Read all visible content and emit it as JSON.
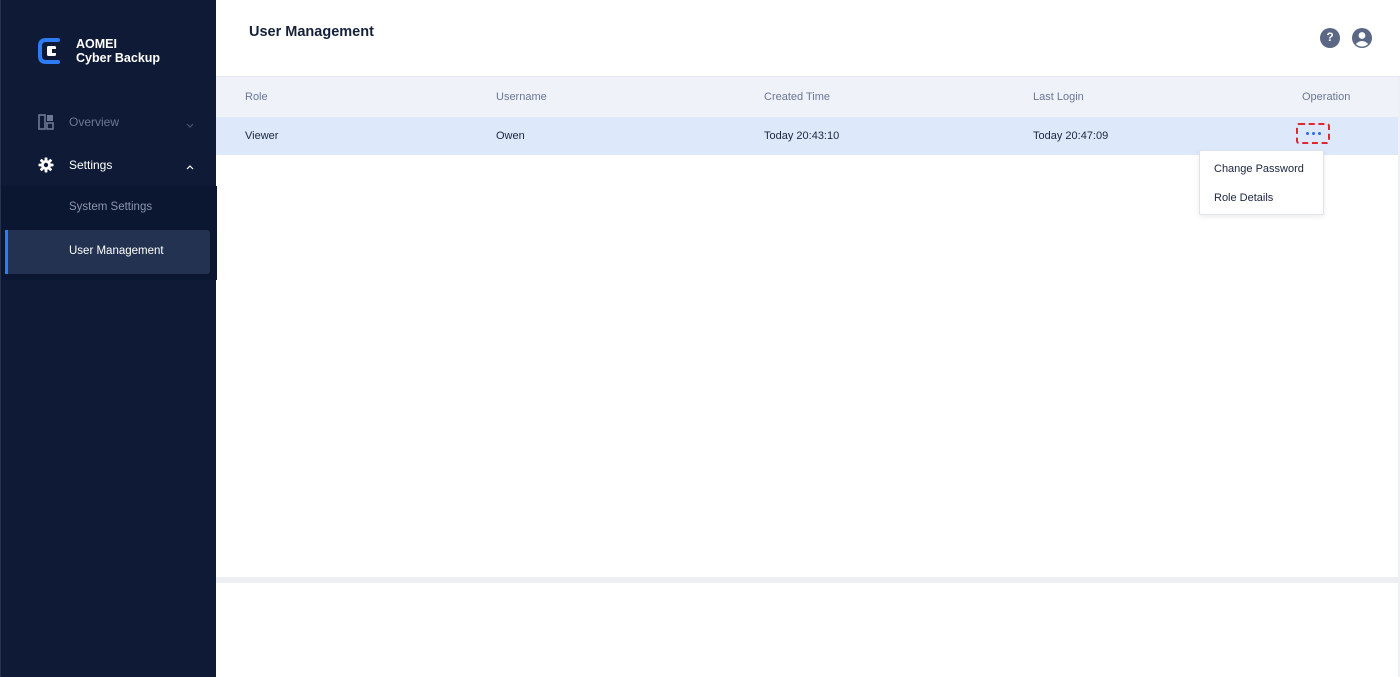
{
  "brand": {
    "line1": "AOMEI",
    "line2": "Cyber Backup",
    "accent_color": "#2d7cf6"
  },
  "sidebar": {
    "items": [
      {
        "label": "Overview",
        "icon": "dashboard-icon",
        "expanded": false
      },
      {
        "label": "Settings",
        "icon": "gear-icon",
        "expanded": true,
        "children": [
          {
            "label": "System Settings",
            "active": false
          },
          {
            "label": "User Management",
            "active": true
          }
        ]
      }
    ]
  },
  "header": {
    "title": "User Management",
    "icons": [
      "help-icon",
      "account-icon"
    ],
    "help_glyph": "?"
  },
  "table": {
    "columns": [
      "Role",
      "Username",
      "Created Time",
      "Last Login",
      "Operation"
    ],
    "rows": [
      {
        "role": "Viewer",
        "username": "Owen",
        "created": "Today 20:43:10",
        "last_login": "Today 20:47:09"
      }
    ]
  },
  "operation_menu": {
    "items": [
      "Change Password",
      "Role Details"
    ],
    "highlight_color": "#e0262f"
  }
}
